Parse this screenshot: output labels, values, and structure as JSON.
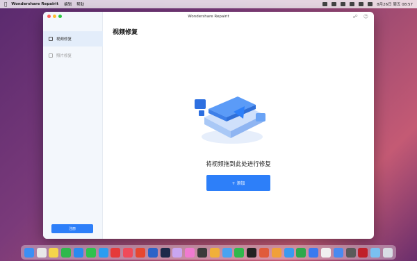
{
  "menubar": {
    "app_name": "Wondershare Repairit",
    "menu_items": [
      "编辑",
      "帮助"
    ],
    "clock": "8月26日 周五 08:57"
  },
  "window": {
    "title": "Wondershare Repairit"
  },
  "sidebar": {
    "items": [
      {
        "label": "视频修复",
        "icon": "video-icon",
        "active": true
      },
      {
        "label": "照片修复",
        "icon": "photo-icon",
        "active": false
      }
    ],
    "register_label": "注册"
  },
  "main": {
    "page_title": "视频修复",
    "drop_text": "将视频拖到此处进行修复",
    "add_label": "+ 添加"
  },
  "colors": {
    "accent": "#2d7ff9",
    "sidebar_bg": "#f3f7fc"
  },
  "dock": {
    "icons": [
      "finder-icon",
      "launchpad-icon",
      "notes-icon",
      "facetime-icon",
      "safari-icon",
      "wechat-icon",
      "qq-icon",
      "app-icon",
      "music-icon",
      "app-icon",
      "vpn-icon",
      "photoshop-icon",
      "app-icon",
      "app-icon",
      "app-icon",
      "app-icon",
      "chrome-icon",
      "app-icon",
      "terminal-icon",
      "app-icon",
      "app-icon",
      "app-icon",
      "app-icon",
      "app-icon",
      "app-icon",
      "app-icon",
      "app-icon",
      "app-icon",
      "folder-icon",
      "trash-icon"
    ]
  }
}
